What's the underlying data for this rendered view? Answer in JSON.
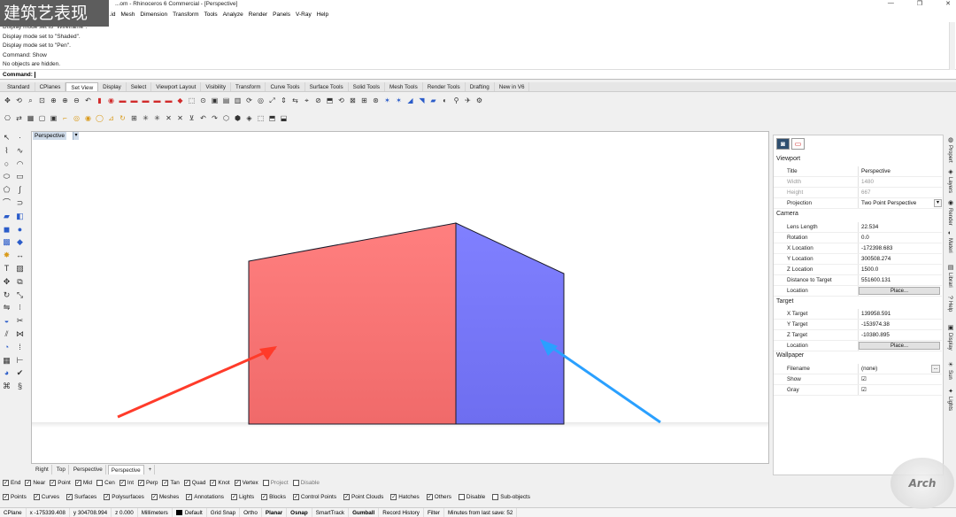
{
  "window": {
    "title": "...om - Rhinoceros 6 Commercial - [Perspective]",
    "watermark": "建筑艺表现",
    "controls": [
      "—",
      "❐",
      "✕"
    ]
  },
  "menu": [
    "...id",
    "Mesh",
    "Dimension",
    "Transform",
    "Tools",
    "Analyze",
    "Render",
    "Panels",
    "V-Ray",
    "Help"
  ],
  "history": [
    "Display mode set to \"Wireframe\".",
    "Display mode set to \"Shaded\".",
    "Display mode set to \"Pen\".",
    "Command: Show",
    "No objects are hidden."
  ],
  "command": {
    "label": "Command:"
  },
  "tabs": [
    "Standard",
    "CPlanes",
    "Set View",
    "Display",
    "Select",
    "Viewport Layout",
    "Visibility",
    "Transform",
    "Curve Tools",
    "Surface Tools",
    "Solid Tools",
    "Mesh Tools",
    "Render Tools",
    "Drafting",
    "New in V6"
  ],
  "active_tab": "Set View",
  "viewport": {
    "label": "Perspective",
    "dropdown": "▾",
    "colors": {
      "front_face": "#ff7f7f",
      "side_face": "#8080ff",
      "red_arrow": "#ff3b2a",
      "blue_arrow": "#2aa0ff"
    }
  },
  "viewport_tabs": [
    "Right",
    "Top",
    "Perspective",
    "Perspective",
    "+"
  ],
  "osnaps": [
    {
      "label": "End",
      "checked": true
    },
    {
      "label": "Near",
      "checked": true
    },
    {
      "label": "Point",
      "checked": true
    },
    {
      "label": "Mid",
      "checked": true
    },
    {
      "label": "Cen",
      "checked": false
    },
    {
      "label": "Int",
      "checked": true
    },
    {
      "label": "Perp",
      "checked": true
    },
    {
      "label": "Tan",
      "checked": true
    },
    {
      "label": "Quad",
      "checked": true
    },
    {
      "label": "Knot",
      "checked": true
    },
    {
      "label": "Vertex",
      "checked": true
    },
    {
      "label": "Project",
      "checked": false
    },
    {
      "label": "Disable",
      "checked": false
    }
  ],
  "filters": [
    {
      "label": "Points",
      "checked": true
    },
    {
      "label": "Curves",
      "checked": true
    },
    {
      "label": "Surfaces",
      "checked": true
    },
    {
      "label": "Polysurfaces",
      "checked": true
    },
    {
      "label": "Meshes",
      "checked": true
    },
    {
      "label": "Annotations",
      "checked": true
    },
    {
      "label": "Lights",
      "checked": true
    },
    {
      "label": "Blocks",
      "checked": true
    },
    {
      "label": "Control Points",
      "checked": true
    },
    {
      "label": "Point Clouds",
      "checked": true
    },
    {
      "label": "Hatches",
      "checked": true
    },
    {
      "label": "Others",
      "checked": true
    },
    {
      "label": "Disable",
      "checked": false
    },
    {
      "label": "Sub-objects",
      "checked": false
    }
  ],
  "status": {
    "cplane": "CPlane",
    "x": "x -175339.408",
    "y": "y 304708.994",
    "z": "z 0.000",
    "units": "Millimeters",
    "layer": "Default",
    "grid_snap": "Grid Snap",
    "ortho": "Ortho",
    "planar": "Planar",
    "osnap": "Osnap",
    "smarttrack": "SmartTrack",
    "gumball": "Gumball",
    "record_history": "Record History",
    "filter": "Filter",
    "save_msg": "Minutes from last save: 52"
  },
  "properties": {
    "viewport_section": "Viewport",
    "viewport_rows": [
      {
        "label": "Title",
        "value": "Perspective"
      },
      {
        "label": "Width",
        "value": "1480"
      },
      {
        "label": "Height",
        "value": "667"
      },
      {
        "label": "Projection",
        "value": "Two Point Perspective"
      }
    ],
    "camera_section": "Camera",
    "camera_rows": [
      {
        "label": "Lens Length",
        "value": "22.534"
      },
      {
        "label": "Rotation",
        "value": "0.0"
      },
      {
        "label": "X Location",
        "value": "-172398.683"
      },
      {
        "label": "Y Location",
        "value": "300508.274"
      },
      {
        "label": "Z Location",
        "value": "1500.0"
      },
      {
        "label": "Distance to Target",
        "value": "551600.131"
      },
      {
        "label": "Location",
        "value": "Place..."
      }
    ],
    "target_section": "Target",
    "target_rows": [
      {
        "label": "X Target",
        "value": "139958.591"
      },
      {
        "label": "Y Target",
        "value": "-153974.38"
      },
      {
        "label": "Z Target",
        "value": "-10380.895"
      },
      {
        "label": "Location",
        "value": "Place..."
      }
    ],
    "wallpaper_section": "Wallpaper",
    "wallpaper_rows": [
      {
        "label": "Filename",
        "value": "(none)"
      },
      {
        "label": "Show",
        "value": "☑"
      },
      {
        "label": "Gray",
        "value": "☑"
      }
    ],
    "more_button": "..."
  },
  "side_tabs": [
    "Propert",
    "Layers",
    "Render",
    "Materi",
    "Librari",
    "Help",
    "Display",
    "Sun",
    "Lights"
  ],
  "brand": "Arch"
}
